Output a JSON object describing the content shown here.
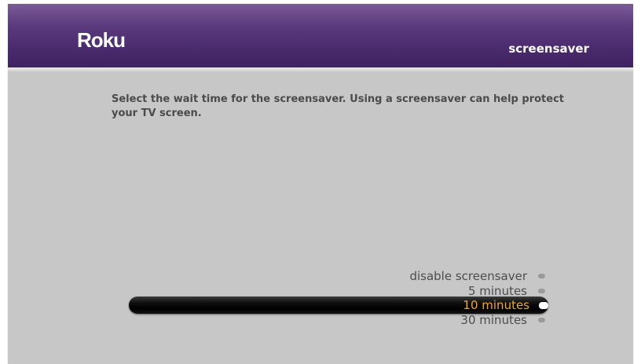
{
  "header": {
    "logo_text": "Roku",
    "title": "screensaver"
  },
  "description": "Select the wait time for the screensaver. Using a screensaver can help protect your TV screen.",
  "options": [
    {
      "label": "disable screensaver",
      "selected": false
    },
    {
      "label": "5 minutes",
      "selected": false
    },
    {
      "label": "10 minutes",
      "selected": true
    },
    {
      "label": "30 minutes",
      "selected": false
    }
  ],
  "colors": {
    "header": "#4a2b6d",
    "background": "#c7c7c7",
    "text": "#4b4b4b",
    "selected_text": "#f2a81f",
    "selection_bar": "#000000"
  },
  "icons": {
    "option_marker": "rounded-rect-marker",
    "logo": "roku-logo"
  }
}
